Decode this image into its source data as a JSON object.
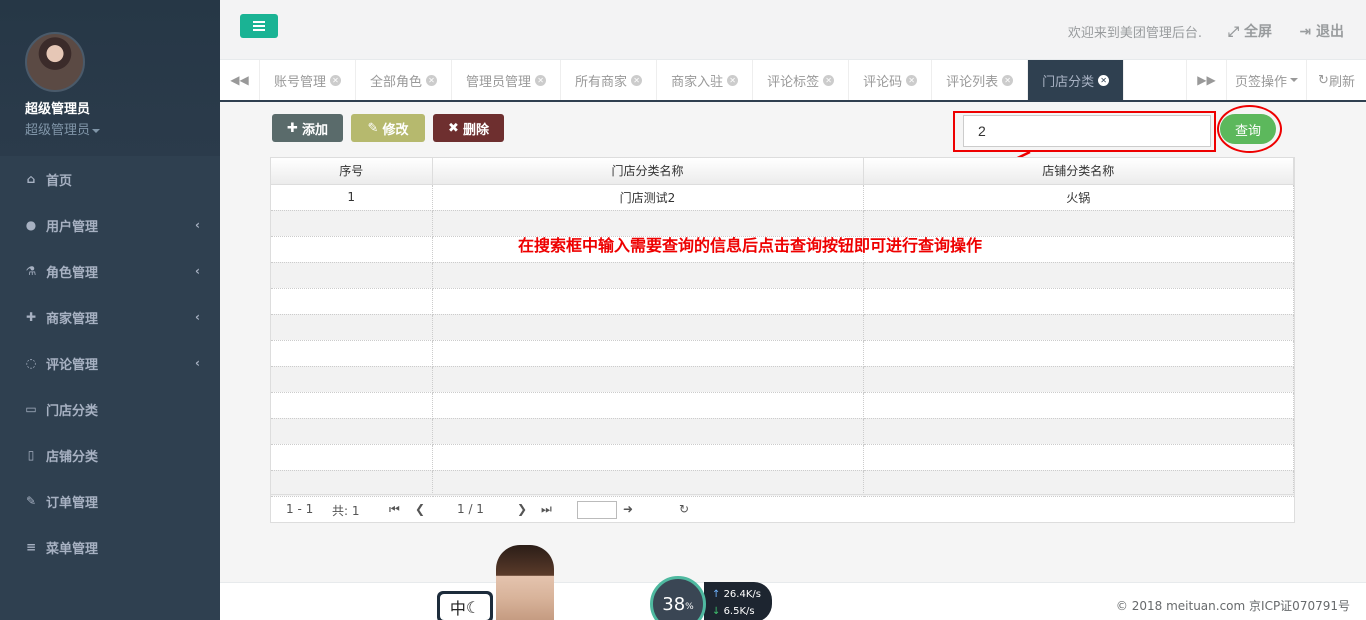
{
  "sidebar": {
    "user_name": "超级管理员",
    "user_role": "超级管理员",
    "items": [
      {
        "label": "首页",
        "icon": "home-icon"
      },
      {
        "label": "用户管理",
        "icon": "user-icon"
      },
      {
        "label": "角色管理",
        "icon": "flask-icon"
      },
      {
        "label": "商家管理",
        "icon": "user-plus-icon"
      },
      {
        "label": "评论管理",
        "icon": "comment-icon"
      },
      {
        "label": "门店分类",
        "icon": "desktop-icon"
      },
      {
        "label": "店铺分类",
        "icon": "document-icon"
      },
      {
        "label": "订单管理",
        "icon": "edit-icon"
      },
      {
        "label": "菜单管理",
        "icon": "list-icon"
      }
    ]
  },
  "header": {
    "welcome": "欢迎来到美团管理后台.",
    "fullscreen": "全屏",
    "logout": "退出"
  },
  "tabs": {
    "items": [
      "账号管理",
      "全部角色",
      "管理员管理",
      "所有商家",
      "商家入驻",
      "评论标签",
      "评论码",
      "评论列表",
      "门店分类"
    ],
    "active": "门店分类",
    "page_ops": "页签操作",
    "refresh": "刷新"
  },
  "toolbar": {
    "add": "添加",
    "edit": "修改",
    "delete": "删除",
    "search_value": "2",
    "query": "查询"
  },
  "table": {
    "columns": [
      "序号",
      "门店分类名称",
      "店铺分类名称"
    ],
    "rows": [
      [
        "1",
        "门店测试2",
        "火锅"
      ]
    ]
  },
  "pager": {
    "range": "1 - 1",
    "total": "共: 1",
    "page": "1 / 1"
  },
  "annotation": "在搜索框中输入需要查询的信息后点击查询按钮即可进行查询操作",
  "footer": {
    "copyright": "© 2018 meituan.com 京ICP证070791号",
    "ime": "中",
    "speed_percent": "38",
    "speed_unit": "%",
    "up_speed": "26.4K/s",
    "down_speed": "6.5K/s"
  },
  "colors": {
    "sidebar": "#2f4050",
    "accent": "#1ab394",
    "annotation": "#ee0000"
  }
}
